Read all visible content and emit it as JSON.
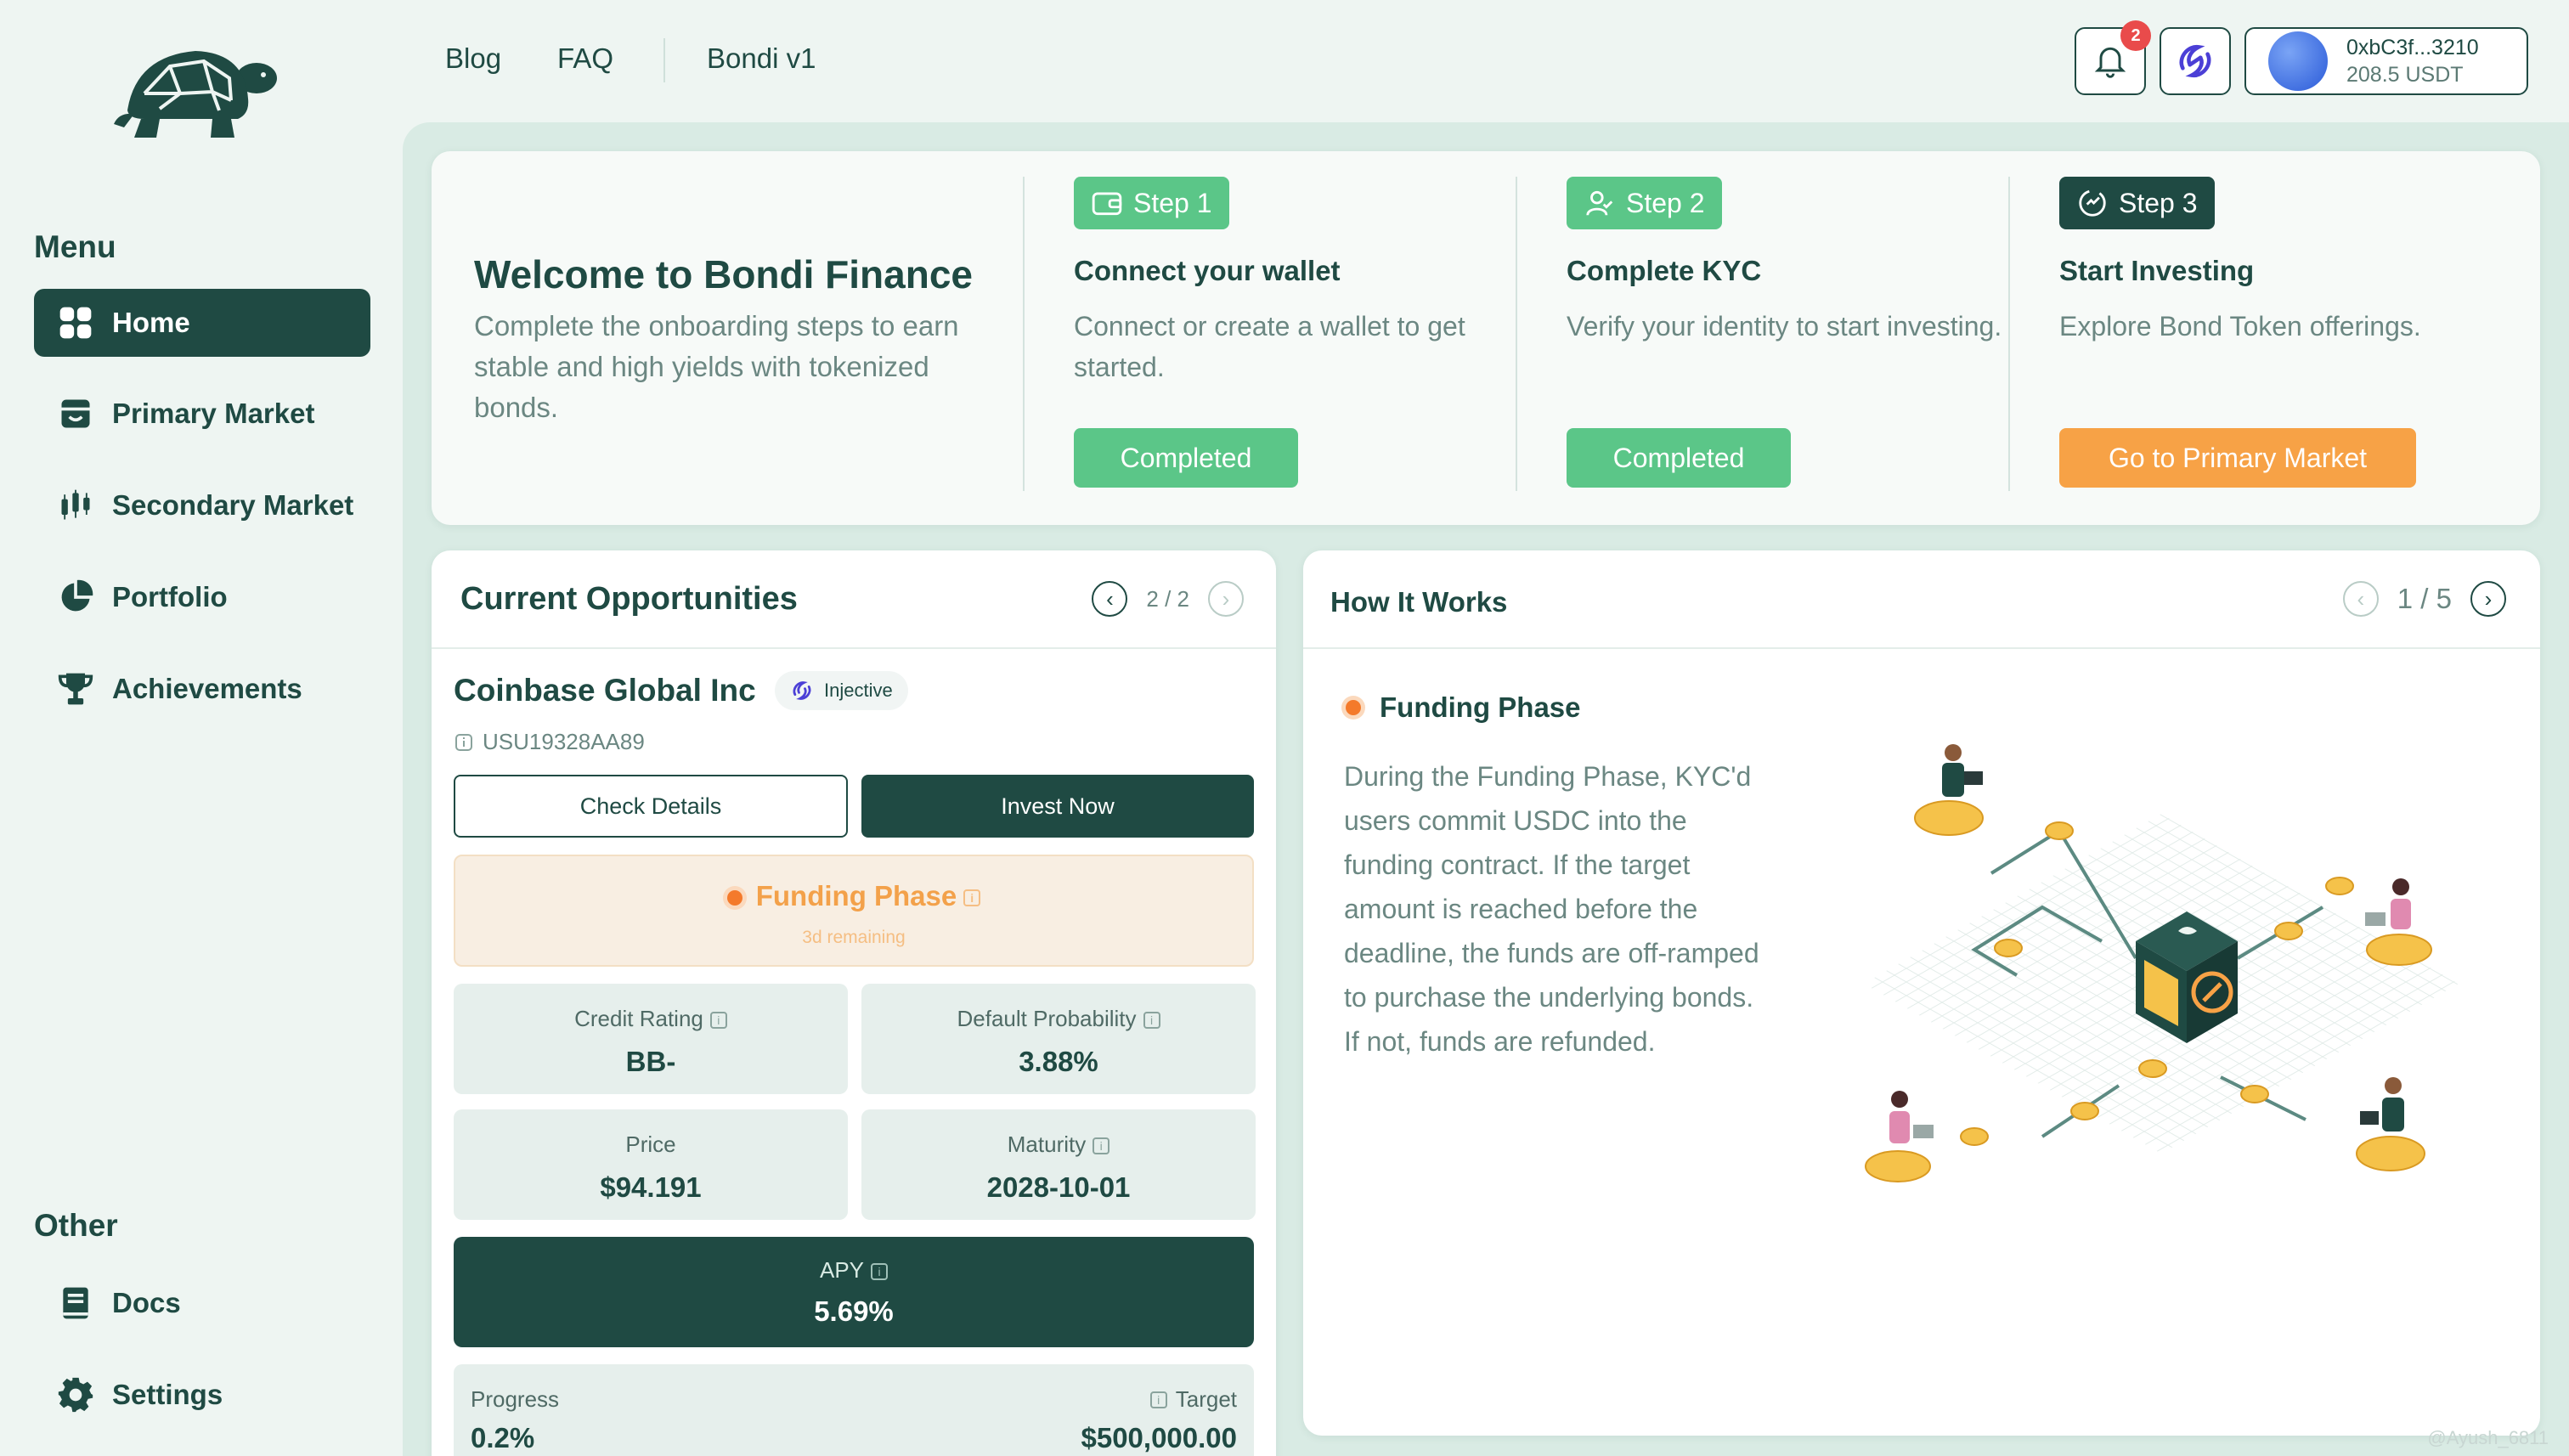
{
  "header": {
    "links": [
      "Blog",
      "FAQ",
      "Bondi v1"
    ],
    "notification_count": "2",
    "wallet": {
      "address": "0xbC3f...3210",
      "balance": "208.5 USDT"
    }
  },
  "sidebar": {
    "menu_title": "Menu",
    "items": [
      {
        "label": "Home",
        "icon": "grid-icon",
        "active": true
      },
      {
        "label": "Primary Market",
        "icon": "store-icon"
      },
      {
        "label": "Secondary Market",
        "icon": "candlestick-icon"
      },
      {
        "label": "Portfolio",
        "icon": "pie-chart-icon"
      },
      {
        "label": "Achievements",
        "icon": "trophy-icon"
      }
    ],
    "other_title": "Other",
    "other_items": [
      {
        "label": "Docs",
        "icon": "book-icon"
      },
      {
        "label": "Settings",
        "icon": "gear-icon"
      }
    ]
  },
  "welcome": {
    "title": "Welcome to Bondi Finance",
    "description": "Complete the onboarding steps to earn stable and high yields with tokenized bonds.",
    "steps": [
      {
        "badge": "Step 1",
        "title": "Connect your wallet",
        "description": "Connect or create a wallet to get started.",
        "action": "Completed",
        "status": "completed"
      },
      {
        "badge": "Step 2",
        "title": "Complete KYC",
        "description": "Verify your identity to start investing.",
        "action": "Completed",
        "status": "completed"
      },
      {
        "badge": "Step 3",
        "title": "Start Investing",
        "description": "Explore Bond Token offerings.",
        "action": "Go to Primary Market",
        "status": "pending"
      }
    ]
  },
  "opportunities": {
    "title": "Current Opportunities",
    "pager": "2 / 2",
    "bond": {
      "name": "Coinbase Global Inc",
      "chain": "Injective",
      "id": "USU19328AA89",
      "check_details": "Check Details",
      "invest_now": "Invest Now",
      "phase": "Funding Phase",
      "phase_remaining": "3d remaining",
      "credit_rating_label": "Credit Rating",
      "credit_rating": "BB-",
      "default_prob_label": "Default Probability",
      "default_prob": "3.88%",
      "price_label": "Price",
      "price": "$94.191",
      "maturity_label": "Maturity",
      "maturity": "2028-10-01",
      "apy_label": "APY",
      "apy": "5.69%",
      "progress_label": "Progress",
      "progress": "0.2%",
      "target_label": "Target",
      "target": "$500,000.00"
    }
  },
  "how_it_works": {
    "title": "How It Works",
    "pager": "1 / 5",
    "phase": "Funding Phase",
    "text": "During the Funding Phase, KYC'd users commit USDC into the funding contract. If the target amount is reached before the deadline, the funds are off-ramped to purchase the underlying bonds. If not, funds are refunded."
  },
  "watermark": "@Ayush_6811",
  "colors": {
    "primary": "#1f4a43",
    "success": "#5bc688",
    "accent": "#f7a246",
    "background": "#eef5f2"
  }
}
